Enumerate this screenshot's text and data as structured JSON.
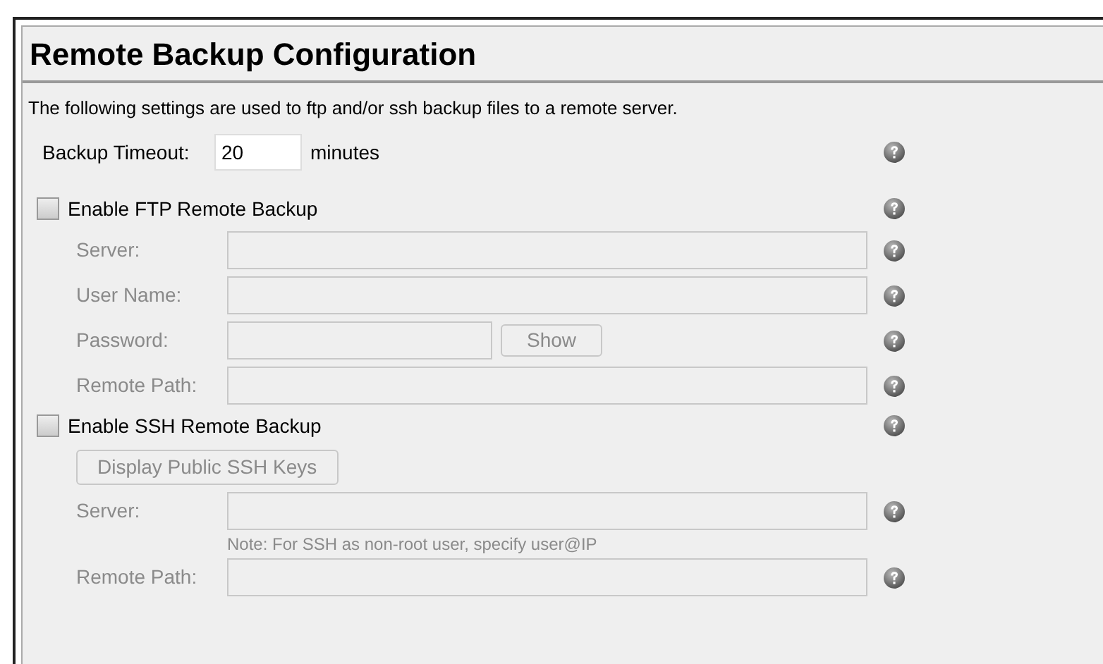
{
  "panel": {
    "title": "Remote Backup Configuration",
    "description": "The following settings are used to ftp and/or ssh backup files to a remote server."
  },
  "rows": [
    {
      "kind": "timeout",
      "label": "Backup Timeout:",
      "value": "20",
      "unit": "minutes",
      "help": true
    },
    {
      "kind": "checkbox",
      "label": "Enable FTP Remote Backup",
      "checked": false,
      "help": true
    },
    {
      "kind": "field",
      "label": "Server:",
      "disabled": true,
      "help": true
    },
    {
      "kind": "field",
      "label": "User Name:",
      "disabled": true,
      "help": true
    },
    {
      "kind": "password",
      "label": "Password:",
      "button": "Show",
      "disabled": true,
      "help": true
    },
    {
      "kind": "field",
      "label": "Remote Path:",
      "disabled": true,
      "help": true
    },
    {
      "kind": "checkbox",
      "label": "Enable SSH Remote Backup",
      "checked": false,
      "help": true
    },
    {
      "kind": "button",
      "label": "Display Public SSH Keys",
      "disabled": true
    },
    {
      "kind": "field",
      "label": "Server:",
      "disabled": true,
      "help": true
    },
    {
      "kind": "note",
      "label": "Note: For SSH as non-root user, specify user@IP",
      "disabled": true
    },
    {
      "kind": "field",
      "label": "Remote Path:",
      "disabled": true,
      "help": true
    }
  ]
}
